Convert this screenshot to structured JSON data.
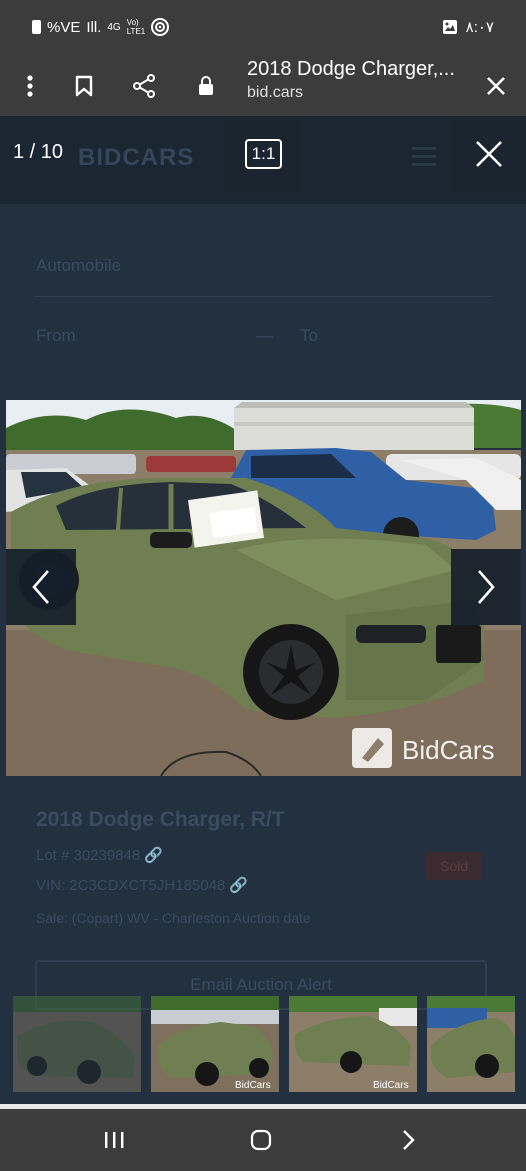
{
  "status_bar": {
    "left_text": "%VE",
    "signal_text": "Ill.",
    "network_text": "4G",
    "volte_top": "Vo)",
    "volte_bottom": "LTE1",
    "time": "٨:٠٧"
  },
  "toolbar": {
    "page_title": "2018 Dodge Charger,...",
    "url": "bid.cars"
  },
  "page": {
    "logo": "BIDCARS",
    "filter_type": "Automobile",
    "from_label": "From",
    "dash": "—",
    "to_label": "To",
    "listing_title": "2018 Dodge Charger, R/T",
    "lot_line": "Lot # 30239848 🔗",
    "vin_line": "VIN: 2C3CDXCT5JH185048 🔗",
    "location_line": "Sale: (Copart) WV - Charleston  Auction date",
    "badge": "Sold",
    "cta": "Email Auction Alert"
  },
  "viewer": {
    "counter": "1 / 10",
    "zoom_label": "1:1",
    "watermark": "BidCars",
    "thumb_watermark": "BidCars",
    "current_index": 1,
    "total": 10
  },
  "colors": {
    "car_green": "#6f7f52",
    "background": "#1f2a36",
    "system_bar": "#3c3c3c"
  },
  "icons": [
    "menu-dots-icon",
    "bookmark-icon",
    "share-icon",
    "lock-icon",
    "close-icon",
    "chevron-left-icon",
    "chevron-right-icon",
    "recent-apps-icon",
    "home-icon",
    "back-icon"
  ]
}
